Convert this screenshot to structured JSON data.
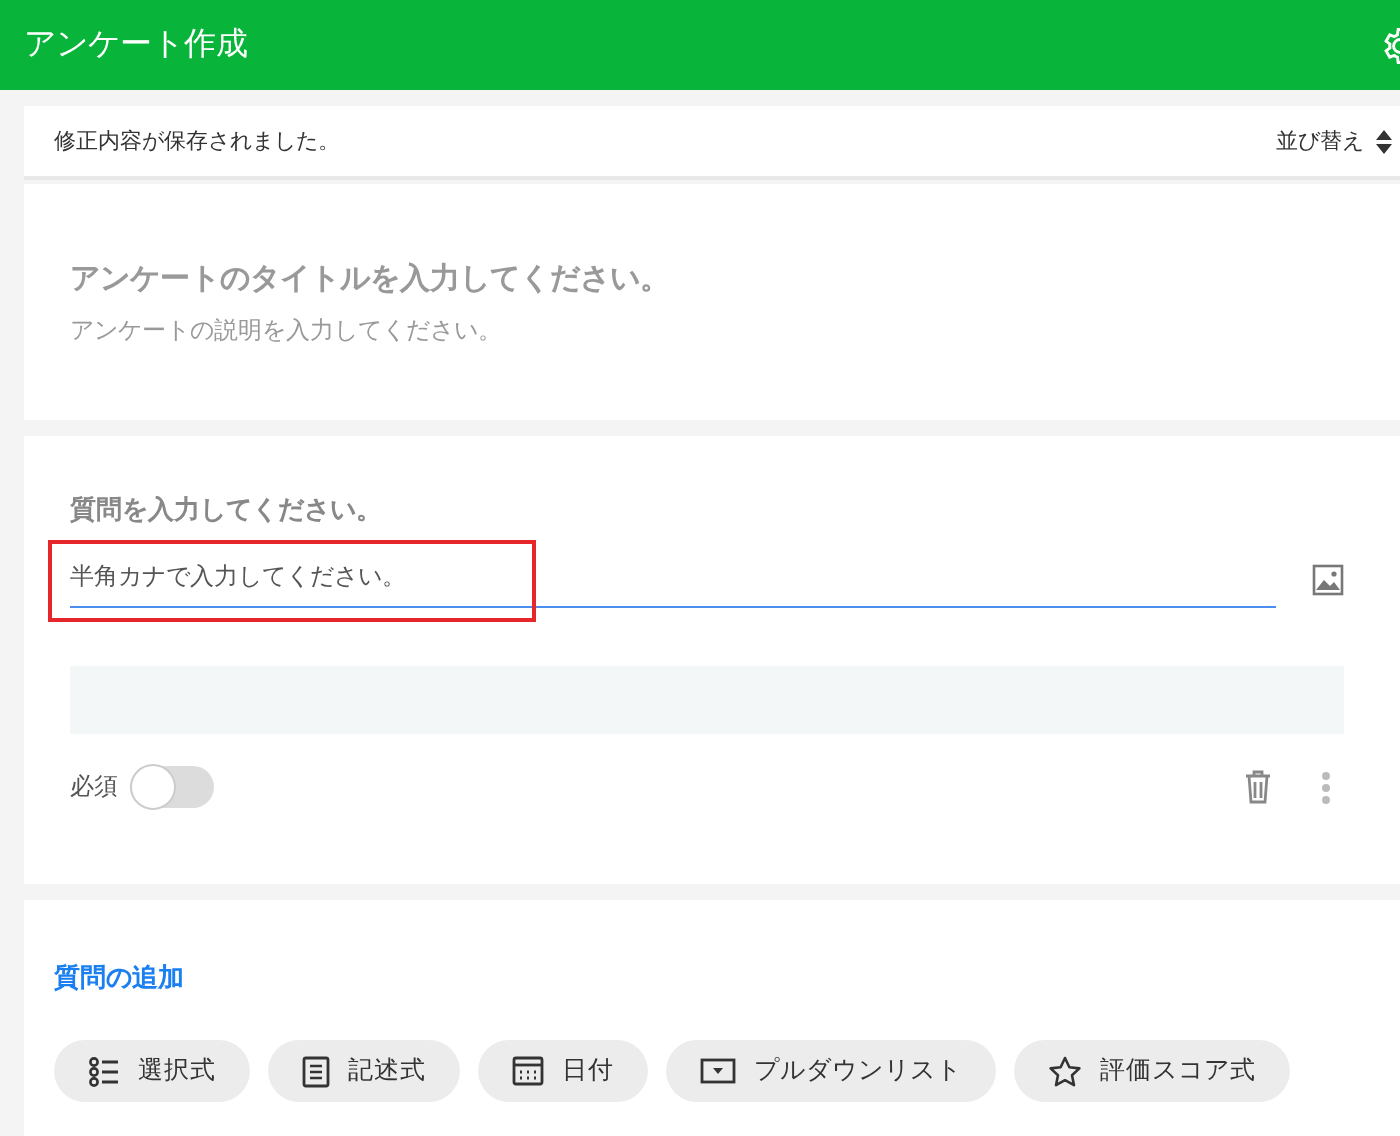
{
  "header": {
    "title": "アンケート作成"
  },
  "status_bar": {
    "message": "修正内容が保存されました。",
    "sort_label": "並び替え"
  },
  "survey": {
    "title_placeholder": "アンケートのタイトルを入力してください。",
    "description_placeholder": "アンケートの説明を入力してください。"
  },
  "question": {
    "placeholder": "質問を入力してください。",
    "answer_value": "半角カナで入力してください。",
    "highlighted": true,
    "required_label": "必須",
    "required": false
  },
  "add_question": {
    "heading": "質問の追加",
    "types": [
      {
        "kind": "choice",
        "label": "選択式"
      },
      {
        "kind": "text",
        "label": "記述式"
      },
      {
        "kind": "date",
        "label": "日付"
      },
      {
        "kind": "dropdown",
        "label": "プルダウンリスト"
      },
      {
        "kind": "rating",
        "label": "評価スコア式"
      }
    ]
  }
}
